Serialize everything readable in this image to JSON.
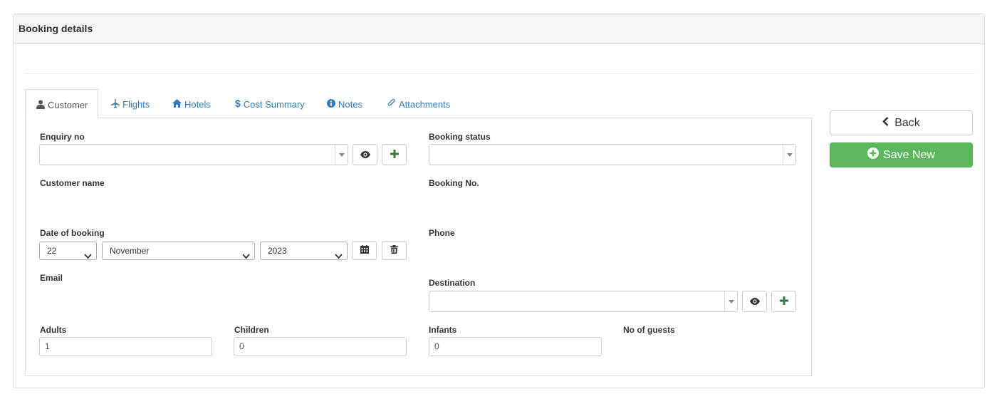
{
  "panel": {
    "title": "Booking details"
  },
  "tabs": [
    {
      "label": "Customer",
      "icon": "user-icon"
    },
    {
      "label": "Flights",
      "icon": "plane-icon"
    },
    {
      "label": "Hotels",
      "icon": "home-icon"
    },
    {
      "label": "Cost Summary",
      "icon": "dollar-icon"
    },
    {
      "label": "Notes",
      "icon": "info-icon"
    },
    {
      "label": "Attachments",
      "icon": "paperclip-icon"
    }
  ],
  "form": {
    "enquiry_no": {
      "label": "Enquiry no",
      "value": ""
    },
    "booking_status": {
      "label": "Booking status",
      "value": ""
    },
    "customer_name": {
      "label": "Customer name"
    },
    "booking_no": {
      "label": "Booking No."
    },
    "date_of_booking": {
      "label": "Date of booking",
      "day": "22",
      "month": "November",
      "year": "2023"
    },
    "phone": {
      "label": "Phone"
    },
    "email": {
      "label": "Email"
    },
    "destination": {
      "label": "Destination",
      "value": ""
    },
    "adults": {
      "label": "Adults",
      "value": "1"
    },
    "children": {
      "label": "Children",
      "value": "0"
    },
    "infants": {
      "label": "Infants",
      "value": "0"
    },
    "no_of_guests": {
      "label": "No of guests"
    }
  },
  "actions": {
    "back_label": "Back",
    "save_label": "Save New"
  },
  "colors": {
    "link": "#337ab7",
    "success": "#5cb85c",
    "plus_icon": "#3c763d",
    "border": "#dddddd"
  }
}
